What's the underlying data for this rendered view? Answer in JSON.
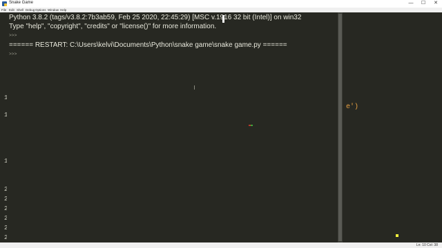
{
  "window": {
    "title": "Snake Game",
    "minimize_label": "—",
    "maximize_label": "☐",
    "close_label": "✕"
  },
  "menu": {
    "items": [
      "File",
      "Edit",
      "Shell",
      "Debug",
      "Options",
      "Window",
      "Help"
    ]
  },
  "shell": {
    "banner_line1": "Python 3.8.2 (tags/v3.8.2:7b3ab59, Feb 25 2020, 22:45:29) [MSC v.1916 32 bit (Intel)] on win32",
    "banner_line2": "Type \"help\", \"copyright\", \"credits\" or \"license()\" for more information.",
    "prompt": ">>>",
    "restart_line": "====== RESTART: C:\\Users\\kelvi\\Documents\\Python\\snake game\\snake game.py ======"
  },
  "gutter": {
    "digits": [
      "1",
      "1",
      "1",
      "2",
      "2",
      "2",
      "2",
      "2",
      "2"
    ]
  },
  "right_editor": {
    "fragment": "e')"
  },
  "status": {
    "position": "Ln: 10  Col: 38"
  },
  "colors": {
    "background": "#272822",
    "text": "#e8e8dc",
    "string": "#e6a043",
    "snake_body": "#b43a2a",
    "snake_head": "#3fa33b",
    "food": "#f5f53c"
  }
}
